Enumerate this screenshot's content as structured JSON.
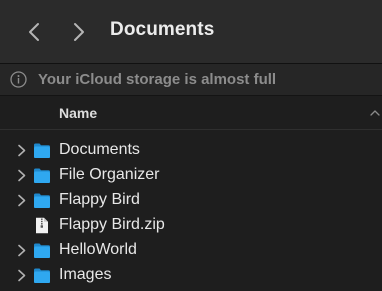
{
  "toolbar": {
    "title": "Documents",
    "back_icon": "chevron-left-icon",
    "forward_icon": "chevron-right-icon"
  },
  "banner": {
    "icon": "info-icon",
    "text": "Your iCloud storage is almost full"
  },
  "columns": {
    "name_header": "Name"
  },
  "colors": {
    "folder": "#2fa8f0",
    "folder_tab": "#1f88cc",
    "text": "#e8e8e8",
    "muted_text": "#8c8c8c"
  },
  "files": [
    {
      "name": "Documents",
      "kind": "folder",
      "expandable": true
    },
    {
      "name": "File Organizer",
      "kind": "folder",
      "expandable": true
    },
    {
      "name": "Flappy Bird",
      "kind": "folder",
      "expandable": true
    },
    {
      "name": "Flappy Bird.zip",
      "kind": "archive",
      "expandable": false
    },
    {
      "name": "HelloWorld",
      "kind": "folder",
      "expandable": true
    },
    {
      "name": "Images",
      "kind": "folder",
      "expandable": true
    }
  ]
}
